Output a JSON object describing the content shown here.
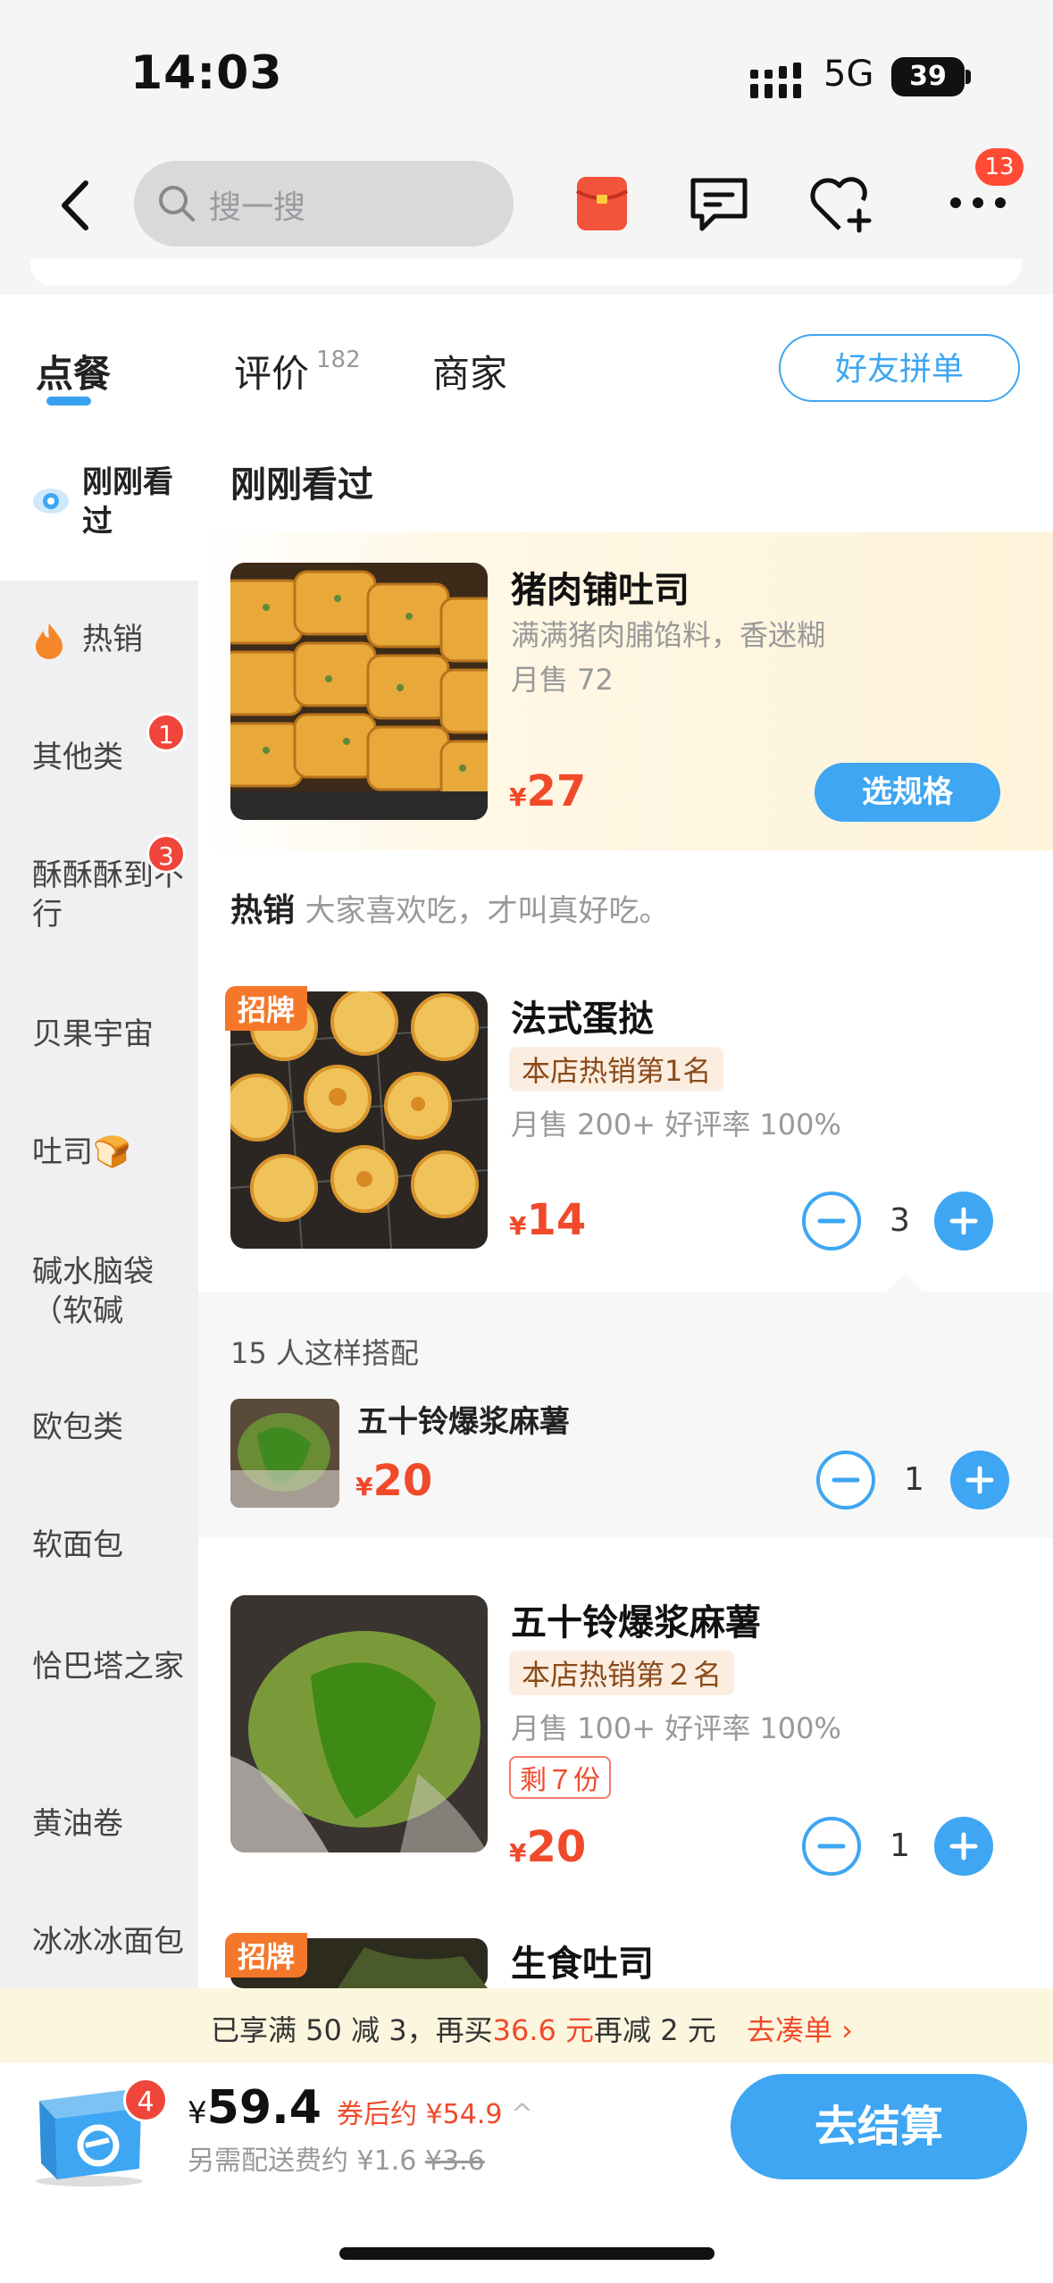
{
  "status": {
    "time": "14:03",
    "network": "5G",
    "battery": "39"
  },
  "nav": {
    "search_placeholder": "搜一搜",
    "more_badge": "13"
  },
  "tabs": {
    "order": "点餐",
    "reviews": "评价",
    "reviews_count": "182",
    "shop": "商家",
    "friend_order": "好友拼单"
  },
  "sidebar": {
    "recent": "刚刚看过",
    "items": [
      {
        "label": "热销"
      },
      {
        "label": "其他类",
        "badge": "1"
      },
      {
        "label": "酥酥酥到不行",
        "badge": "3"
      },
      {
        "label": "贝果宇宙"
      },
      {
        "label": "吐司🍞"
      },
      {
        "label": "碱水脑袋（软碱"
      },
      {
        "label": "欧包类"
      },
      {
        "label": "软面包"
      },
      {
        "label": "恰巴塔之家"
      },
      {
        "label": "黄油卷"
      },
      {
        "label": "冰冰冰面包"
      }
    ]
  },
  "recent_section": {
    "title": "刚刚看过",
    "product": {
      "name": "猪肉铺吐司",
      "desc": "满满猪肉脯馅料，香迷糊",
      "sales": "月售 72",
      "currency": "¥",
      "price": "27",
      "button": "选规格"
    }
  },
  "hot_section": {
    "title": "热销",
    "subtitle": "大家喜欢吃，才叫真好吃。",
    "products": [
      {
        "ribbon": "招牌",
        "name": "法式蛋挞",
        "tag": "本店热销第1名",
        "sales": "月售 200+ 好评率 100%",
        "currency": "¥",
        "price": "14",
        "qty": "3"
      },
      {
        "name": "五十铃爆浆麻薯",
        "tag": "本店热销第２名",
        "sales": "月售 100+ 好评率 100%",
        "stock": "剩７份",
        "currency": "¥",
        "price": "20",
        "qty": "1"
      },
      {
        "ribbon": "招牌",
        "name": "生食吐司"
      }
    ]
  },
  "pairing": {
    "title": "15 人这样搭配",
    "item": {
      "name": "五十铃爆浆麻薯",
      "currency": "¥",
      "price": "20",
      "qty": "1"
    }
  },
  "promo": {
    "text_a": "已享满 50 减 3，再买",
    "amount": "36.6 元",
    "text_b": "再减 2 元",
    "link": "去凑单"
  },
  "cart": {
    "badge": "4",
    "currency": "¥",
    "total": "59.4",
    "coupon_price": "券后约 ¥54.9",
    "delivery": "另需配送费约 ¥1.6",
    "delivery_original": "¥3.6",
    "checkout": "去结算"
  },
  "colors": {
    "accent": "#3ea6f2",
    "price": "#f04a2b",
    "badge": "#f0453a"
  }
}
